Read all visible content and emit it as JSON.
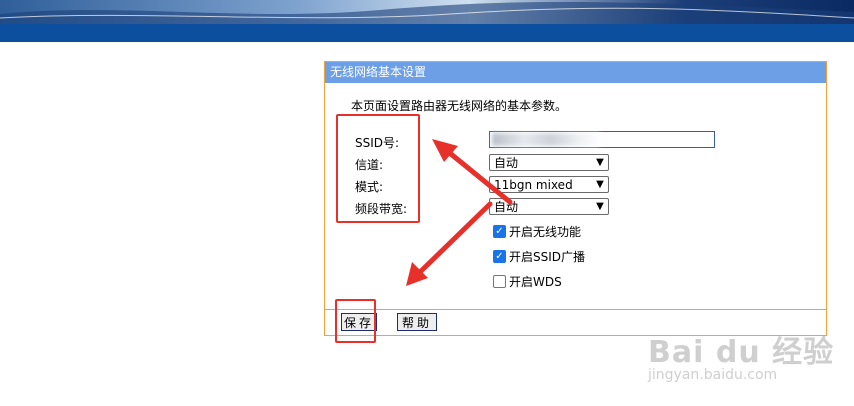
{
  "panel": {
    "title": "无线网络基本设置",
    "intro": "本页面设置路由器无线网络的基本参数。"
  },
  "fields": {
    "ssid_label": "SSID号:",
    "channel_label": "信道:",
    "mode_label": "模式:",
    "bandwidth_label": "频段带宽:",
    "channel_value": "自动",
    "mode_value": "11bgn mixed",
    "bandwidth_value": "自动"
  },
  "checkboxes": {
    "wireless_label": "开启无线功能",
    "wireless_checked": true,
    "ssid_broadcast_label": "开启SSID广播",
    "ssid_broadcast_checked": true,
    "wds_label": "开启WDS",
    "wds_checked": false
  },
  "buttons": {
    "save": "保存",
    "help": "帮助"
  },
  "watermark": {
    "logo": "Bai du 经验",
    "url": "jingyan.baidu.com"
  },
  "colors": {
    "panel_title_bg": "#6d9fe6",
    "panel_border": "#f0a33a",
    "annotation_red": "#e8302a",
    "checkbox_blue": "#1a73e8"
  }
}
